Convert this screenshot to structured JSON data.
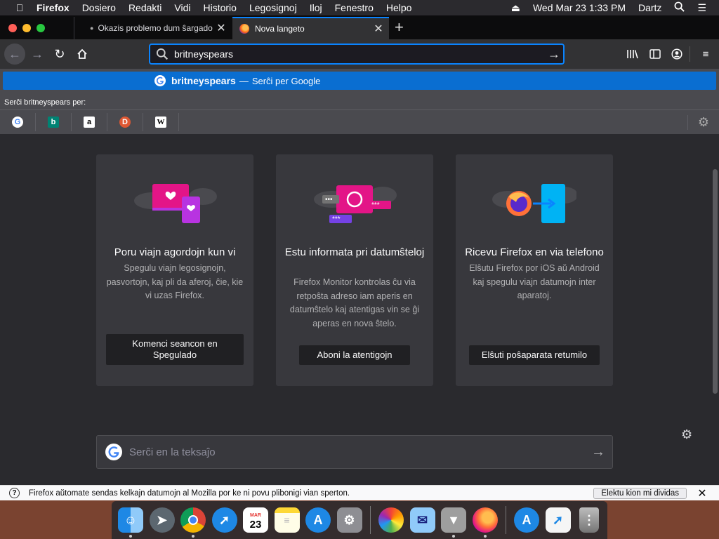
{
  "menubar": {
    "app": "Firefox",
    "items": [
      "Dosiero",
      "Redakti",
      "Vidi",
      "Historio",
      "Legosignoj",
      "Iloj",
      "Fenestro",
      "Helpo"
    ],
    "datetime": "Wed Mar 23  1:33 PM",
    "user": "Dartz"
  },
  "tabs": {
    "inactive_title": "Okazis problemo dum ŝargado",
    "active_title": "Nova langeto"
  },
  "urlbar": {
    "value": "britneyspears"
  },
  "suggestions": {
    "term": "britneyspears",
    "dash": "—",
    "action": "Serĉi per Google",
    "search_with": "Serĉi britneyspears per:",
    "engines": [
      "google-icon",
      "bing-icon",
      "amazon-icon",
      "duckduckgo-icon",
      "wikipedia-icon"
    ]
  },
  "cards": [
    {
      "title": "Poru viajn agordojn kun vi",
      "body": "Spegulu viajn legosignojn, pasvortojn, kaj pli da aferoj, ĉie, kie vi uzas Firefox.",
      "button": "Komenci seancon en Spegulado"
    },
    {
      "title": "Estu informata pri datumŝteloj",
      "body": "Firefox Monitor kontrolas ĉu via retpoŝta adreso iam aperis en datumŝtelo kaj atentigas vin se ĝi aperas en nova ŝtelo.",
      "button": "Aboni la atentigojn"
    },
    {
      "title": "Ricevu Firefox en via telefono",
      "body": "Elŝutu Firefox por iOS aŭ Android kaj spegulu viajn datumojn inter aparatoj.",
      "button": "Elŝuti poŝaparata retumilo"
    }
  ],
  "websearch": {
    "placeholder": "Serĉi en la teksaĵo"
  },
  "notification": {
    "text": "Firefox aŭtomate sendas kelkajn datumojn al Mozilla por ke ni povu plibonigi vian sperton.",
    "button": "Elektu kion mi dividas"
  },
  "calendar": {
    "month": "MAR",
    "day": "23"
  },
  "colors": {
    "accent": "#0a84ff",
    "suggest_highlight": "#0a6ed1",
    "content_bg": "#2a2a2e",
    "card_bg": "#38383d"
  }
}
